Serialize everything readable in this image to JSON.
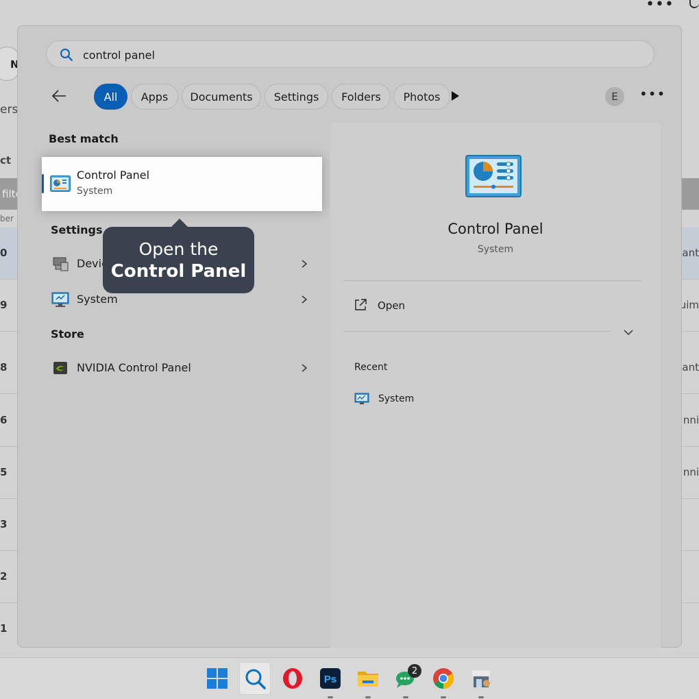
{
  "search": {
    "query": "control panel",
    "placeholder": ""
  },
  "filters": {
    "chips": [
      "All",
      "Apps",
      "Documents",
      "Settings",
      "Folders",
      "Photos"
    ],
    "active": "All",
    "avatar_letter": "E"
  },
  "best_match": {
    "heading": "Best match",
    "title": "Control Panel",
    "subtitle": "System"
  },
  "settings_section": {
    "heading": "Settings",
    "items": [
      {
        "label": "Devic",
        "icon": "device-manager-icon"
      },
      {
        "label": "System",
        "icon": "system-monitor-icon"
      }
    ]
  },
  "store_section": {
    "heading": "Store",
    "items": [
      {
        "label": "NVIDIA Control Panel",
        "icon": "nvidia-icon"
      }
    ]
  },
  "tooltip": {
    "line1": "Open the",
    "line2": "Control Panel"
  },
  "preview": {
    "title": "Control Panel",
    "subtitle": "System",
    "open_label": "Open",
    "recent_heading": "Recent",
    "recent_items": [
      {
        "label": "System",
        "icon": "system-monitor-icon"
      }
    ]
  },
  "taskbar": {
    "apps": [
      {
        "name": "start",
        "icon": "windows-logo-icon"
      },
      {
        "name": "search",
        "icon": "search-icon",
        "active": true
      },
      {
        "name": "opera",
        "icon": "opera-icon"
      },
      {
        "name": "photoshop",
        "icon": "photoshop-icon",
        "text": "Ps"
      },
      {
        "name": "file-explorer",
        "icon": "folder-icon"
      },
      {
        "name": "chat",
        "icon": "chat-icon",
        "badge": "2"
      },
      {
        "name": "chrome",
        "icon": "chrome-icon"
      },
      {
        "name": "store",
        "icon": "store-icon"
      }
    ]
  },
  "background": {
    "pill_text": "N",
    "text_ers": "ers",
    "text_ct": "ct",
    "band_text": "filte",
    "small_text": "ber",
    "row_numbers": [
      "0",
      "9",
      "8",
      "6",
      "5",
      "3",
      "2",
      "1"
    ],
    "row_right": [
      "ant",
      "uim",
      "ant",
      "nni",
      "nni",
      "",
      "",
      ""
    ]
  },
  "colors": {
    "accent": "#0a5fb4",
    "tooltip_bg": "#39424e",
    "panel_bg": "#c9c9c9"
  }
}
